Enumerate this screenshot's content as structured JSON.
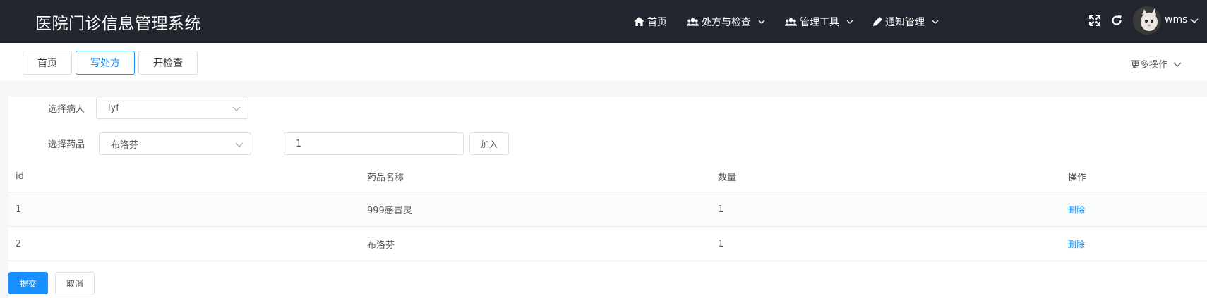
{
  "header": {
    "title": "医院门诊信息管理系统",
    "nav": [
      {
        "label": "首页",
        "icon": "home-icon"
      },
      {
        "label": "处方与检查",
        "icon": "users-icon"
      },
      {
        "label": "管理工具",
        "icon": "users-icon"
      },
      {
        "label": "通知管理",
        "icon": "pen-icon"
      }
    ],
    "username": "wms"
  },
  "tabs": [
    {
      "label": "首页",
      "active": false
    },
    {
      "label": "写处方",
      "active": true
    },
    {
      "label": "开检查",
      "active": false
    }
  ],
  "more_ops": "更多操作",
  "form": {
    "patient_label": "选择病人",
    "patient_value": "lyf",
    "drug_label": "选择药品",
    "drug_value": "布洛芬",
    "quantity_value": "1",
    "add_label": "加入"
  },
  "table": {
    "columns": [
      "id",
      "药品名称",
      "数量",
      "操作"
    ],
    "rows": [
      {
        "id": "1",
        "name": "999感冒灵",
        "qty": "1",
        "action": "删除"
      },
      {
        "id": "2",
        "name": "布洛芬",
        "qty": "1",
        "action": "删除"
      }
    ]
  },
  "actions": {
    "submit": "提交",
    "cancel": "取消"
  },
  "colors": {
    "topbar": "#23262e",
    "accent": "#1890ff"
  }
}
